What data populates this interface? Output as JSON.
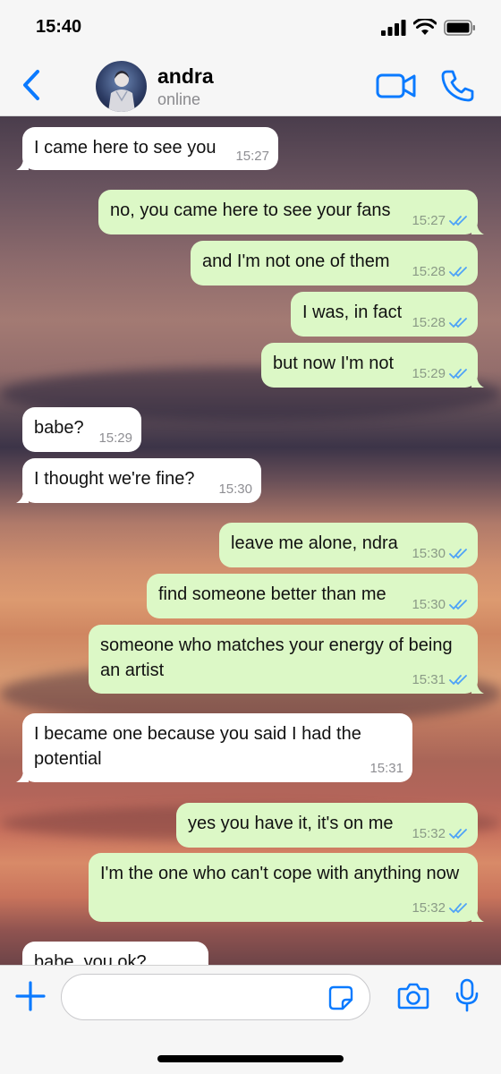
{
  "status_bar": {
    "time": "15:40"
  },
  "header": {
    "contact_name": "andra",
    "contact_status": "online"
  },
  "messages": [
    {
      "dir": "in",
      "text": "I came here to see you",
      "time": "15:27"
    },
    {
      "dir": "out",
      "text": "no, you came here to see your fans",
      "time": "15:27"
    },
    {
      "dir": "out",
      "text": "and I'm not one of them",
      "time": "15:28"
    },
    {
      "dir": "out",
      "text": "I was, in fact",
      "time": "15:28"
    },
    {
      "dir": "out",
      "text": "but now I'm not",
      "time": "15:29"
    },
    {
      "dir": "in",
      "text": "babe?",
      "time": "15:29"
    },
    {
      "dir": "in",
      "text": "I thought we're fine?",
      "time": "15:30"
    },
    {
      "dir": "out",
      "text": "leave me alone, ndra",
      "time": "15:30"
    },
    {
      "dir": "out",
      "text": "find someone better than me",
      "time": "15:30"
    },
    {
      "dir": "out",
      "text": "someone who matches your energy of being an artist",
      "time": "15:31"
    },
    {
      "dir": "in",
      "text": "I became one because you said I had the potential",
      "time": "15:31"
    },
    {
      "dir": "out",
      "text": "yes you have it, it's on me",
      "time": "15:32"
    },
    {
      "dir": "out",
      "text": "I'm the one who can't cope with anything now",
      "time": "15:32"
    },
    {
      "dir": "in",
      "text": "babe, you ok?",
      "time": ""
    }
  ],
  "input": {
    "value": "",
    "placeholder": ""
  },
  "colors": {
    "accent": "#0a7aff",
    "bubble_out": "#dcf8c6",
    "bubble_in": "#ffffff",
    "read_ticks": "#4fa3f7"
  },
  "icons": [
    "back-chevron-icon",
    "video-call-icon",
    "phone-icon",
    "plus-icon",
    "sticker-icon",
    "camera-icon",
    "microphone-icon",
    "double-check-icon"
  ]
}
